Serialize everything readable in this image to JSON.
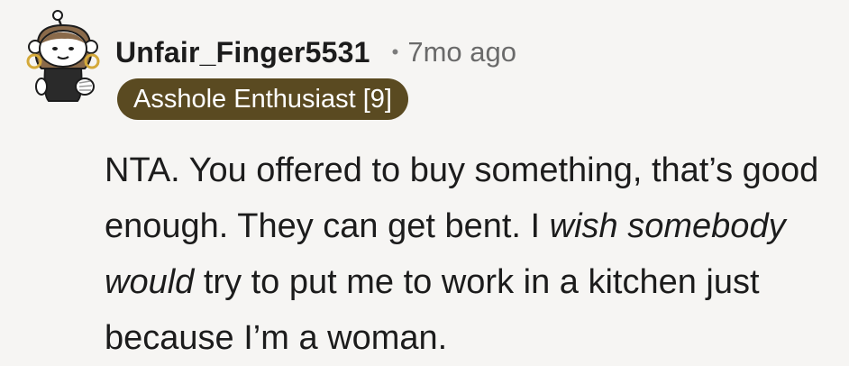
{
  "comment": {
    "author": "Unfair_Finger5531",
    "separator": "•",
    "timestamp": "7mo ago",
    "flair": "Asshole Enthusiast [9]",
    "body": {
      "part1": "NTA. You offered to buy something, that’s good enough. They can get bent. I ",
      "emphasis1": "wish somebody would",
      "part2": " try to put me to work in a kitchen just because I’m a woman."
    }
  },
  "avatar": {
    "icon": "snoo-avatar-icon"
  },
  "colors": {
    "flair_background": "#5a4a21",
    "flair_text": "#ffffff",
    "page_background": "#f6f5f3",
    "text": "#1c1c1c",
    "muted": "#6a6a6a"
  }
}
